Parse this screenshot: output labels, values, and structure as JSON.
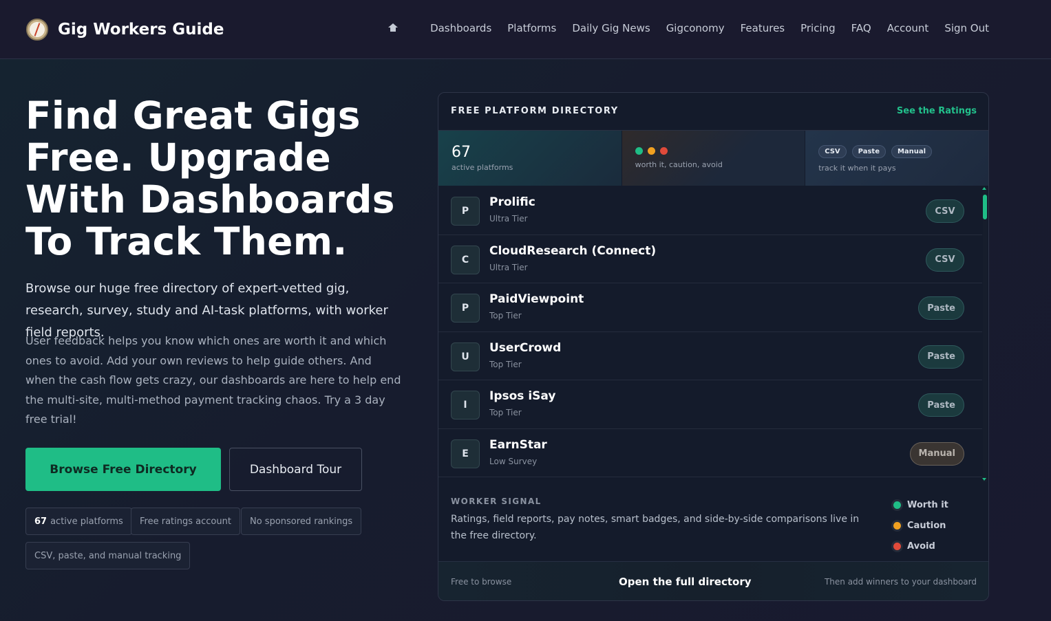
{
  "brand": {
    "name": "Gig Workers Guide"
  },
  "nav": {
    "links": [
      "Dashboards",
      "Platforms",
      "Daily Gig News",
      "Gigconomy",
      "Features",
      "Pricing",
      "FAQ",
      "Account",
      "Sign Out"
    ]
  },
  "hero": {
    "title": "Find Great Gigs Free. Upgrade With Dashboards To Track Them.",
    "lead": "Browse our huge free directory of expert-vetted gig, research, survey, study and AI-task platforms, with worker field reports.",
    "body": "User feedback helps you know which ones are worth it and which ones to avoid. Add your own reviews to help guide others. And when the cash flow gets crazy, our dashboards are here to help end the multi-site, multi-method payment tracking chaos. Try a 3 day free trial!",
    "primary_button": "Browse Free Directory",
    "secondary_button": "Dashboard Tour",
    "chips": {
      "platforms_count": "67",
      "platforms_text": "active platforms",
      "ratings": "Free ratings account",
      "sponsored": "No sponsored rankings",
      "tracking": "CSV, paste, and manual tracking"
    }
  },
  "panel": {
    "title": "FREE PLATFORM DIRECTORY",
    "link": "See the Ratings",
    "stats": {
      "count": "67",
      "count_caption": "active platforms",
      "signal_caption": "worth it, caution, avoid",
      "track_caption": "track it when it pays",
      "pills": [
        "CSV",
        "Paste",
        "Manual"
      ]
    },
    "rows": [
      {
        "initial": "P",
        "name": "Prolific",
        "tier": "Ultra Tier",
        "method": "CSV"
      },
      {
        "initial": "C",
        "name": "CloudResearch (Connect)",
        "tier": "Ultra Tier",
        "method": "CSV"
      },
      {
        "initial": "P",
        "name": "PaidViewpoint",
        "tier": "Top Tier",
        "method": "Paste"
      },
      {
        "initial": "U",
        "name": "UserCrowd",
        "tier": "Top Tier",
        "method": "Paste"
      },
      {
        "initial": "I",
        "name": "Ipsos iSay",
        "tier": "Top Tier",
        "method": "Paste"
      },
      {
        "initial": "E",
        "name": "EarnStar",
        "tier": "Low Survey",
        "method": "Manual"
      }
    ],
    "signal": {
      "label": "WORKER SIGNAL",
      "text": "Ratings, field reports, pay notes, smart badges, and side-by-side comparisons live in the free directory.",
      "legend": [
        "Worth it",
        "Caution",
        "Avoid"
      ]
    },
    "footer": {
      "left": "Free to browse",
      "center": "Open the full directory",
      "right": "Then add winners to your dashboard"
    }
  },
  "colors": {
    "accent": "#1fbd86",
    "worth": "#1fbd86",
    "caution": "#f0a020",
    "avoid": "#e04a3a"
  }
}
